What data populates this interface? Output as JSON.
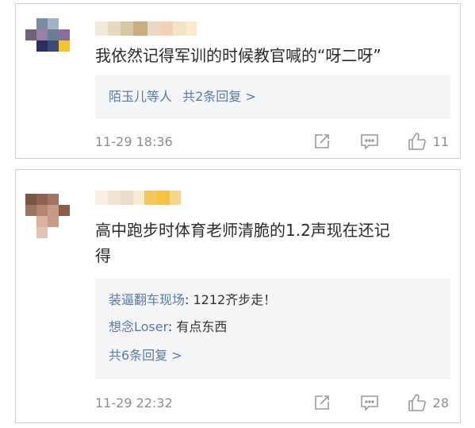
{
  "colors": {
    "link_blue": "#5b7aa6",
    "meta_gray": "#8d8d8d",
    "reply_bg": "#f4f5f7",
    "icon_gray": "#9a9a9a"
  },
  "comments": [
    {
      "avatar": "pixelated-avatar",
      "text": "我依然记得军训的时候教官喊的“呀二呀”",
      "reply_summary": {
        "names": "陌玉儿等人",
        "count_text": "共2条回复 >"
      },
      "time": "11-29 18:36",
      "likes": "11",
      "icons": [
        "share-icon",
        "comment-icon",
        "thumbs-up-icon"
      ]
    },
    {
      "avatar": "pixelated-avatar",
      "text_line1": "高中跑步时体育老师清脆的1.2声现在还记",
      "text_line2": "得",
      "replies": [
        {
          "user": "装逼翻车现场",
          "text": ": 1212齐步走！"
        },
        {
          "user": "想念Loser",
          "text": ": 有点东西"
        }
      ],
      "more_replies": "共6条回复 >",
      "time": "11-29 22:32",
      "likes": "28",
      "icons": [
        "share-icon",
        "comment-icon",
        "thumbs-up-icon"
      ]
    }
  ]
}
